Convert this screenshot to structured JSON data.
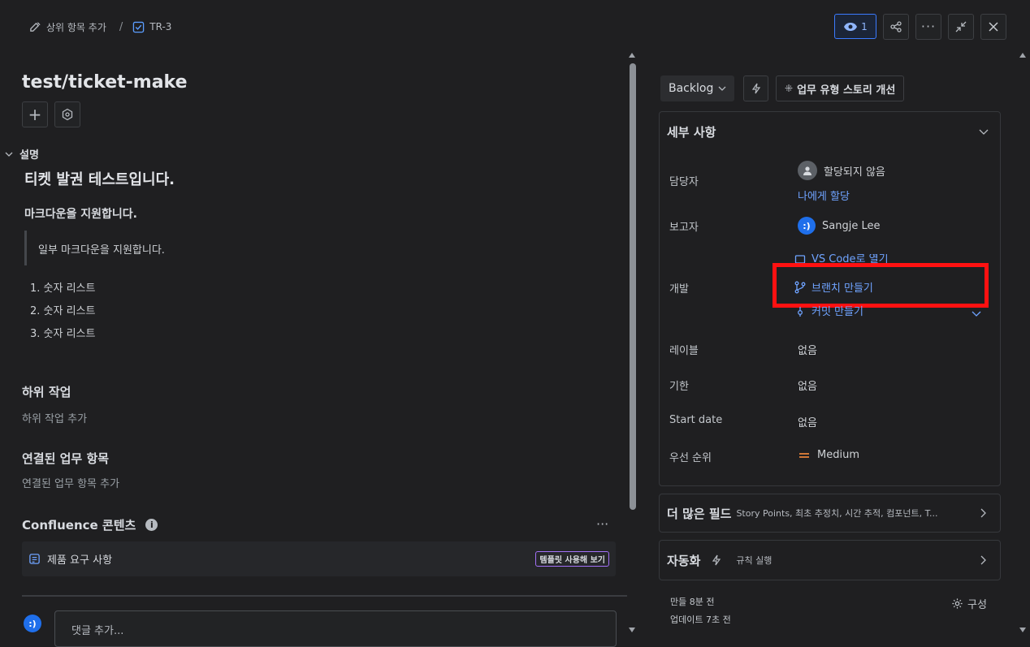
{
  "breadcrumb": {
    "parent_label": "상위 항목 추가",
    "separator": "/",
    "issue_key": "TR-3"
  },
  "top_actions": {
    "watch_count": "1"
  },
  "issue": {
    "title": "test/ticket-make"
  },
  "description": {
    "label": "설명",
    "heading": "티켓 발권 테스트입니다.",
    "subheading": "마크다운을 지원합니다.",
    "quote": "일부 마크다운을 지원합니다.",
    "list": [
      "숫자 리스트",
      "숫자 리스트",
      "숫자 리스트"
    ]
  },
  "subtasks": {
    "title": "하위 작업",
    "add_label": "하위 작업 추가"
  },
  "linked": {
    "title": "연결된 업무 항목",
    "add_label": "연결된 업무 항목 추가"
  },
  "confluence": {
    "title": "Confluence 콘텐츠",
    "item_label": "제품 요구 사항",
    "badge": "템플릿 사용해 보기"
  },
  "comment": {
    "placeholder": "댓글 추가...",
    "avatar_text": ":)"
  },
  "side": {
    "status": "Backlog",
    "improve_label": "업무 유형 스토리 개선",
    "details_title": "세부 사항",
    "fields": {
      "assignee_label": "담당자",
      "assignee_value": "할당되지 않음",
      "assign_me": "나에게 할당",
      "reporter_label": "보고자",
      "reporter_value": "Sangje Lee",
      "reporter_avatar": ":)",
      "dev_label": "개발",
      "dev_vscode": "VS Code로 열기",
      "dev_branch": "브랜치 만들기",
      "dev_commit": "커밋 만들기",
      "labels_label": "레이블",
      "labels_value": "없음",
      "due_label": "기한",
      "due_value": "없음",
      "start_label": "Start date",
      "start_value": "없음",
      "priority_label": "우선 순위",
      "priority_value": "Medium"
    },
    "more_fields_title": "더 많은 필드",
    "more_fields_desc": "Story Points, 최초 추정치, 시간 추적, 컴포넌트, T...",
    "automation_title": "자동화",
    "automation_desc": "규칙 실행",
    "created": "만들 8분 전",
    "updated": "업데이트 7초 전",
    "configure": "구성"
  },
  "colors": {
    "accent_blue": "#1f6feb",
    "link_blue": "#6fa3ff",
    "highlight_red": "#ff1111",
    "priority_orange": "#e8833a",
    "badge_purple": "#a371f7"
  }
}
